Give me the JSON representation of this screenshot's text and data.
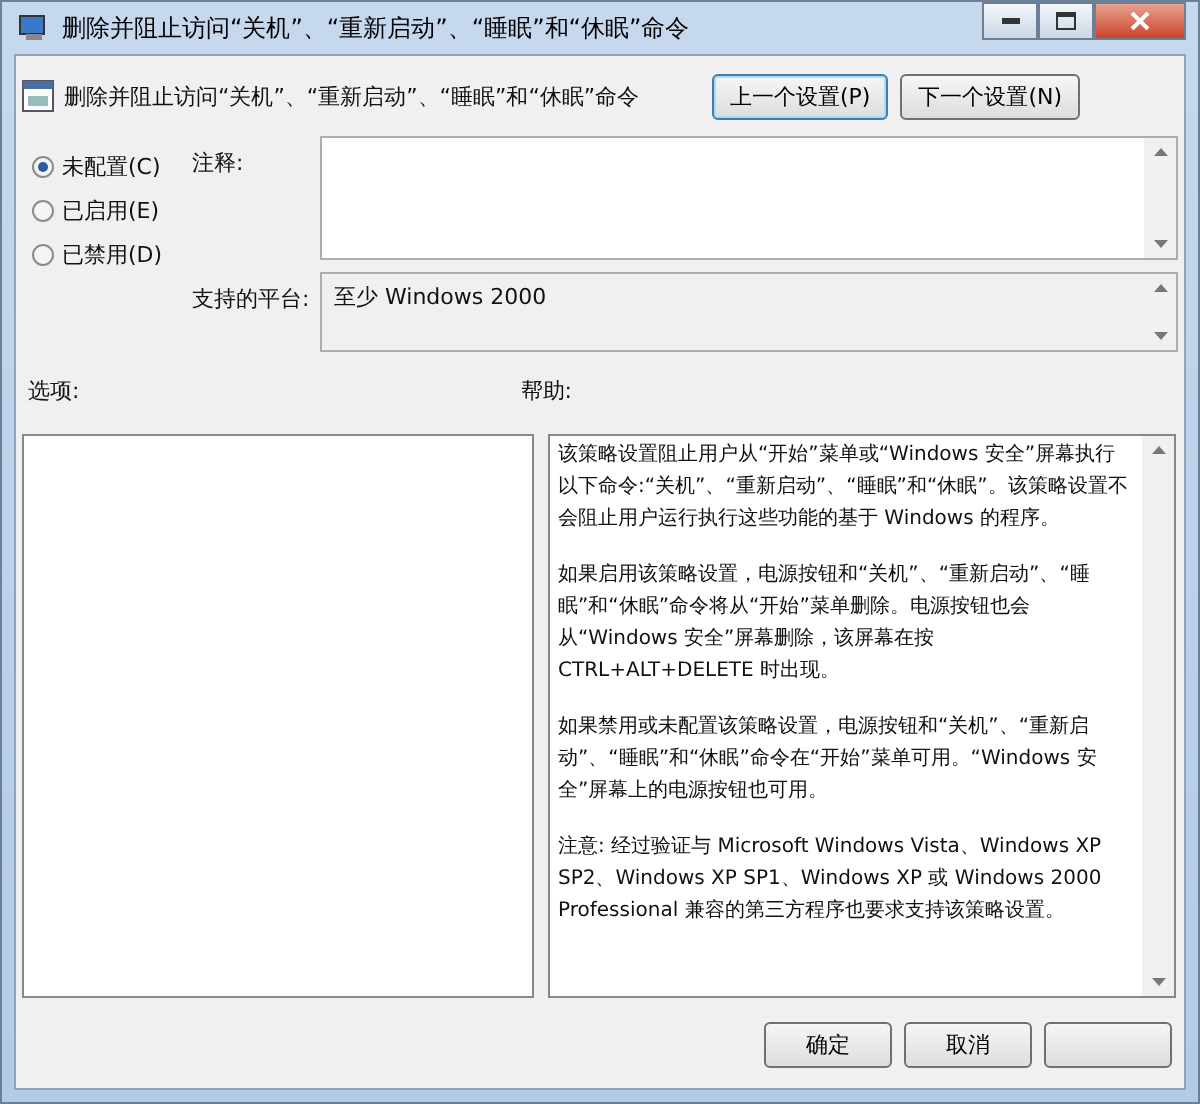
{
  "window": {
    "title": "删除并阻止访问“关机”、“重新启动”、“睡眠”和“休眠”命令"
  },
  "header": {
    "title": "删除并阻止访问“关机”、“重新启动”、“睡眠”和“休眠”命令",
    "buttons": [
      {
        "label": "上一个设置(P)",
        "selected": true
      },
      {
        "label": "下一个设置(N)",
        "selected": false
      }
    ]
  },
  "options": [
    {
      "label": "未配置(C)",
      "selected": true
    },
    {
      "label": "已启用(E)",
      "selected": false
    },
    {
      "label": "已禁用(D)",
      "selected": false
    }
  ],
  "comment": {
    "label": "注释:"
  },
  "platform": {
    "label": "支持的平台:",
    "value": "至少 Windows 2000"
  },
  "options_panel": {
    "label": "选项:"
  },
  "help": {
    "label": "帮助:",
    "paragraphs": [
      "该策略设置阻止用户从“开始”菜单或“Windows 安全”屏幕执行以下命令:“关机”、“重新启动”、“睡眠”和“休眠”。该策略设置不会阻止用户运行执行这些功能的基于 Windows 的程序。",
      "如果启用该策略设置，电源按钮和“关机”、“重新启动”、“睡眠”和“休眠”命令将从“开始”菜单删除。电源按钮也会从“Windows 安全”屏幕删除，该屏幕在按 CTRL+ALT+DELETE 时出现。",
      "如果禁用或未配置该策略设置，电源按钮和“关机”、“重新启动”、“睡眠”和“休眠”命令在“开始”菜单可用。“Windows 安全”屏幕上的电源按钮也可用。",
      "注意: 经过验证与 Microsoft Windows Vista、Windows XP SP2、Windows XP SP1、Windows XP 或 Windows 2000 Professional 兼容的第三方程序也要求支持该策略设置。"
    ]
  },
  "footer": {
    "buttons": [
      {
        "label": "确定"
      },
      {
        "label": "取消"
      }
    ]
  }
}
